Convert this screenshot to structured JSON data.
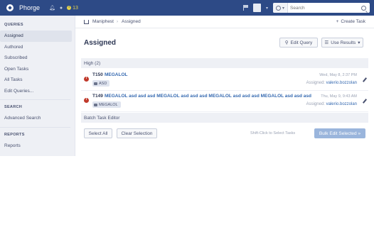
{
  "app": {
    "name": "Phorge",
    "notif_count": "13"
  },
  "search": {
    "placeholder": "Search"
  },
  "sidebar": {
    "queries_header": "QUERIES",
    "items": [
      {
        "label": "Assigned"
      },
      {
        "label": "Authored"
      },
      {
        "label": "Subscribed"
      },
      {
        "label": "Open Tasks"
      },
      {
        "label": "All Tasks"
      },
      {
        "label": "Edit Queries..."
      }
    ],
    "search_header": "SEARCH",
    "advanced_search": "Advanced Search",
    "reports_header": "REPORTS",
    "reports": "Reports"
  },
  "breadcrumb": {
    "app": "Maniphest",
    "current": "Assigned",
    "create_task": "Create Task"
  },
  "page": {
    "title": "Assigned",
    "edit_query": "Edit Query",
    "use_results": "Use Results"
  },
  "group": {
    "header": "High (2)"
  },
  "tasks": [
    {
      "id": "T150",
      "title": "MEGALOL",
      "tag": "ASD",
      "date": "Wed, May 8, 2:37 PM",
      "assigned_label": "Assigned:",
      "assignee": "valerio.bozzolan"
    },
    {
      "id": "T149",
      "title": "MEGALOL asd asd asd MEGALOL asd asd asd MEGALOL asd asd asd MEGALOL asd asd asd",
      "tag": "MEGALOL",
      "date": "Thu, May 9, 9:43 AM",
      "assigned_label": "Assigned:",
      "assignee": "valerio.bozzolan"
    }
  ],
  "batch": {
    "header": "Batch Task Editor",
    "select_all": "Select All",
    "clear_selection": "Clear Selection",
    "hint": "Shift-Click to Select Tasks",
    "bulk_edit": "Bulk Edit Selected »"
  },
  "colors": {
    "topbar": "#2d4a86",
    "link": "#3569b0",
    "priority_high": "#c0392b",
    "sidebar_bg": "#eef0f5"
  }
}
